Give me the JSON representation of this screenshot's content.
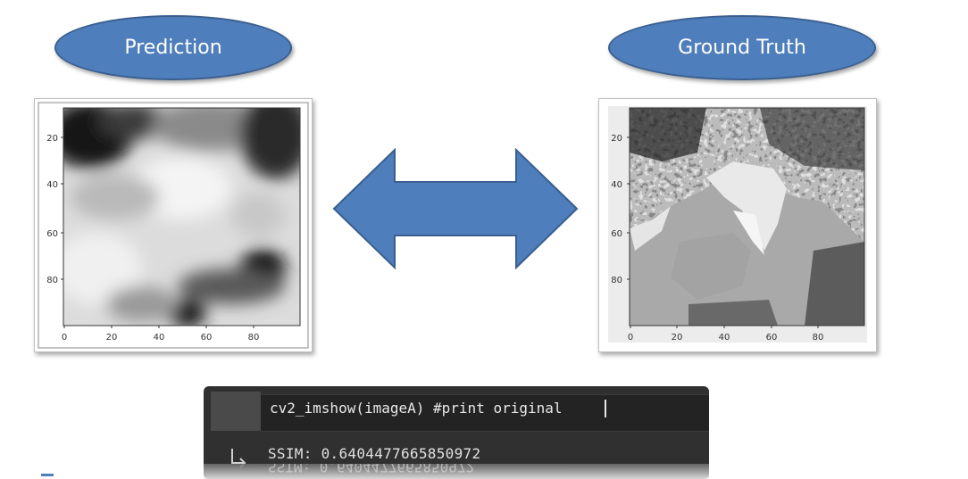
{
  "labels": {
    "prediction": "Prediction",
    "ground_truth": "Ground Truth"
  },
  "plots": {
    "prediction": {
      "y_ticks": [
        "20",
        "40",
        "60",
        "80"
      ],
      "x_ticks": [
        "0",
        "20",
        "40",
        "60",
        "80"
      ]
    },
    "ground_truth": {
      "y_ticks": [
        "20",
        "40",
        "60",
        "80"
      ],
      "x_ticks": [
        "0",
        "20",
        "40",
        "60",
        "80"
      ]
    }
  },
  "arrow": {
    "icon": "double-arrow-icon"
  },
  "code": {
    "line": "cv2_imshow(imageA) #print original",
    "output": "SSIM: 0.6404477665850972",
    "output_icon": "output-arrow-icon"
  },
  "colors": {
    "accent": "#4f7ebc",
    "code_bg": "#303030"
  }
}
